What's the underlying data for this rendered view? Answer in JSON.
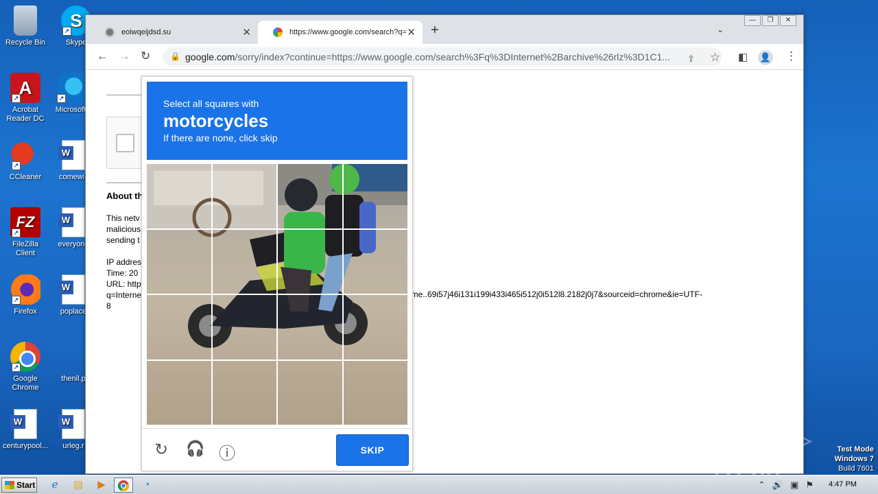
{
  "desktop": {
    "icons": [
      {
        "label": "Recycle Bin"
      },
      {
        "label": "Skype"
      },
      {
        "label": "Acrobat Reader DC"
      },
      {
        "label": "Microsoft"
      },
      {
        "label": "CCleaner"
      },
      {
        "label": "comewill"
      },
      {
        "label": "FileZilla Client"
      },
      {
        "label": "everyone"
      },
      {
        "label": "Firefox"
      },
      {
        "label": "poplace"
      },
      {
        "label": "Google Chrome"
      },
      {
        "label": "thenil.p"
      },
      {
        "label": "centurypool..."
      },
      {
        "label": "urleg.r"
      }
    ]
  },
  "browser": {
    "tabs": [
      {
        "title": "eoiwqeijdsd.su",
        "close": "✕"
      },
      {
        "title": "https://www.google.com/search?q=",
        "close": "✕"
      }
    ],
    "new_tab": "+",
    "tab_search": "⌄",
    "window_controls": [
      "—",
      "❐",
      "✕"
    ],
    "nav": {
      "back": "←",
      "forward": "→",
      "reload": "↻"
    },
    "url_host": "google.com",
    "url_rest": "/sorry/index?continue=https://www.google.com/search%3Fq%3DInternet%2Barchive%26rlz%3D1C1...",
    "profile_icon": "👤",
    "menu_icon": "⋮"
  },
  "page": {
    "about_heading": "About th",
    "paragraph": [
      "This netv",
      "malicious",
      "sending t"
    ],
    "info": [
      "IP addres",
      "Time: 20",
      "URL: http",
      "q=Interne",
      "8"
    ],
    "url_tail": "ome..69i57j46i131i199i433i465i512j0i512l8.2182j0j7&sourceid=chrome&ie=UTF-"
  },
  "captcha": {
    "instruction_line1": "Select all squares with",
    "target_object": "motorcycles",
    "instruction_line3": "If there are none, click skip",
    "tiles": 16,
    "skip_label": "SKIP",
    "reload_icon": "↻",
    "audio_icon": "🎧",
    "info_icon": "ⓘ",
    "header_color": "#1a73e8"
  },
  "taskbar": {
    "start_label": "Start",
    "clock": "4:47 PM"
  },
  "watermark": {
    "brand": "ANY ▷ RUN",
    "test_mode": "Test Mode",
    "os": "Windows 7",
    "build": "Build 7601"
  }
}
